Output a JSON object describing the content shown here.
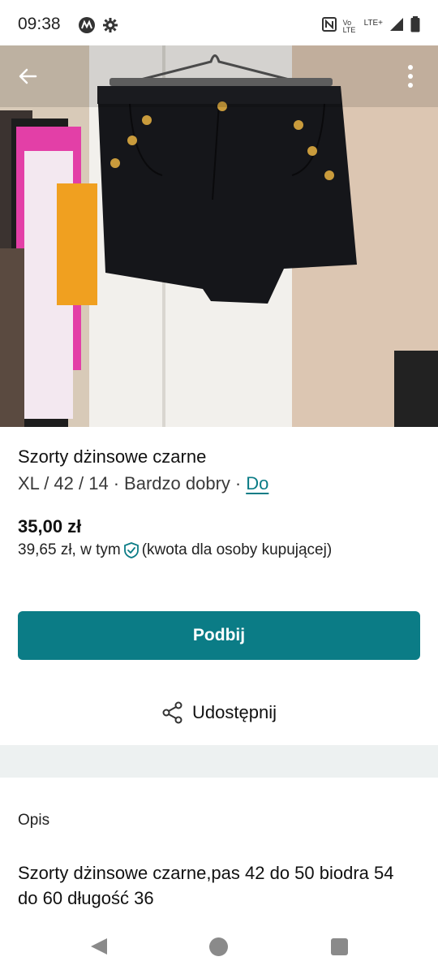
{
  "status_bar": {
    "time": "09:38",
    "left_icons": [
      "motorola-icon",
      "gear-icon"
    ],
    "right_icons": [
      "nfc-icon",
      "volte-icon",
      "lte-signal-icon",
      "battery-icon"
    ],
    "volte_text": "Vo LTE",
    "lte_text": "LTE+"
  },
  "hero": {
    "image": "photo-icon",
    "back_icon": "back-arrow-icon",
    "more_icon": "more-vert-icon"
  },
  "item": {
    "title": "Szorty dżinsowe czarne",
    "size": "XL / 42 / 14",
    "separator1": "·",
    "condition": "Bardzo dobry",
    "separator2": "·",
    "brand": "Do"
  },
  "pricing": {
    "price": "35,00 zł",
    "total_prefix": "39,65 zł, w tym",
    "total_suffix": "(kwota dla osoby kupującej)",
    "accent_color": "#0b7c86"
  },
  "actions": {
    "bump_label": "Podbij",
    "share_label": "Udostępnij"
  },
  "description": {
    "heading": "Opis",
    "text": "Szorty dżinsowe czarne,pas 42 do 50 biodra 54 do 60 długość 36"
  },
  "nav": {
    "icons": [
      "nav-back-icon",
      "nav-home-icon",
      "nav-recents-icon"
    ]
  }
}
